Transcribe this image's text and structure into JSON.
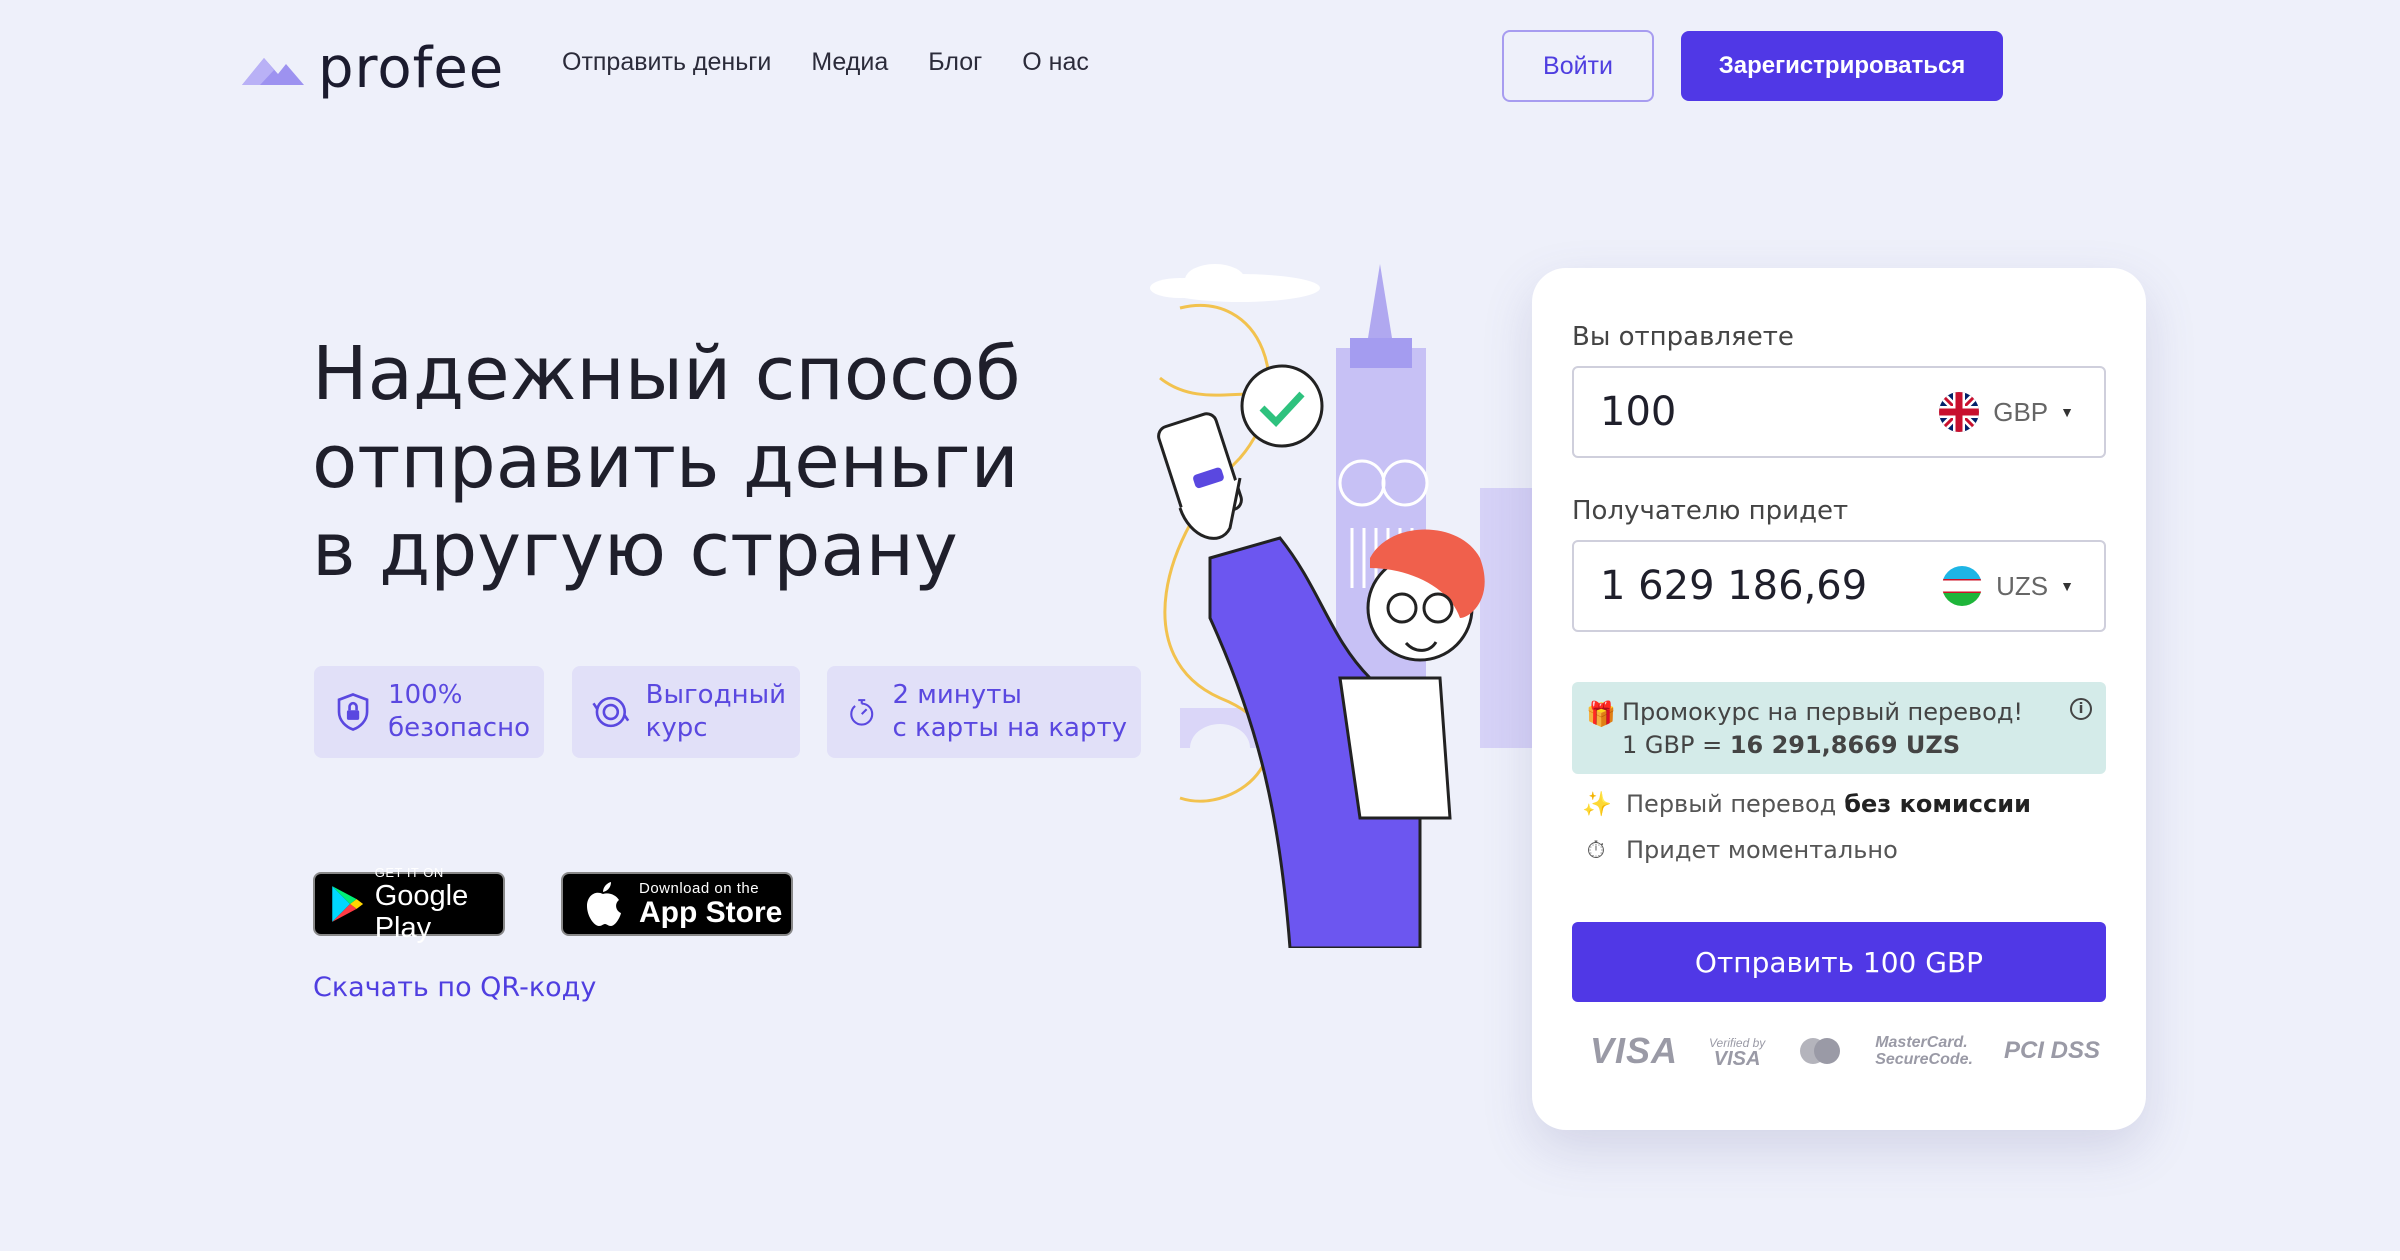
{
  "header": {
    "logo_text": "profee",
    "nav": [
      "Отправить деньги",
      "Медиа",
      "Блог",
      "О нас"
    ],
    "login_label": "Войти",
    "register_label": "Зарегистрироваться"
  },
  "hero": {
    "title_lines": [
      "Надежный способ",
      "отправить деньги",
      "в другую страну"
    ],
    "features": [
      {
        "icon": "shield-lock-icon",
        "line1": "100%",
        "line2": "безопасно"
      },
      {
        "icon": "currency-exchange-icon",
        "line1": "Выгодный",
        "line2": "курс"
      },
      {
        "icon": "stopwatch-icon",
        "line1": "2 минуты",
        "line2": "с карты на карту"
      }
    ],
    "google_play": {
      "small": "GET IT ON",
      "big": "Google Play"
    },
    "app_store": {
      "small": "Download on the",
      "big": "App Store"
    },
    "qr_link": "Скачать по QR-коду"
  },
  "converter": {
    "send_label": "Вы отправляете",
    "send_amount": "100",
    "send_currency": "GBP",
    "receive_label": "Получателю придет",
    "receive_amount": "1 629 186,69",
    "receive_currency": "UZS",
    "promo_line1": "Промокурс на первый перевод!",
    "promo_rate_prefix": "1 GBP = ",
    "promo_rate_value": "16 291,8669 UZS",
    "perk1_text": "Первый перевод",
    "perk1_bold": "без комиссии",
    "perk2_text": "Придет моментально",
    "send_button": "Отправить 100 GBP",
    "payments": {
      "visa": "VISA",
      "vbv_small": "Verified by",
      "vbv_big": "VISA",
      "mc_line1": "MasterCard.",
      "mc_line2": "SecureCode.",
      "pci": "PCI DSS"
    }
  },
  "colors": {
    "accent": "#5038e6",
    "background": "#eef0fa",
    "promo_bg": "#d4ebe9",
    "feature_bg": "#e1e0f8"
  }
}
